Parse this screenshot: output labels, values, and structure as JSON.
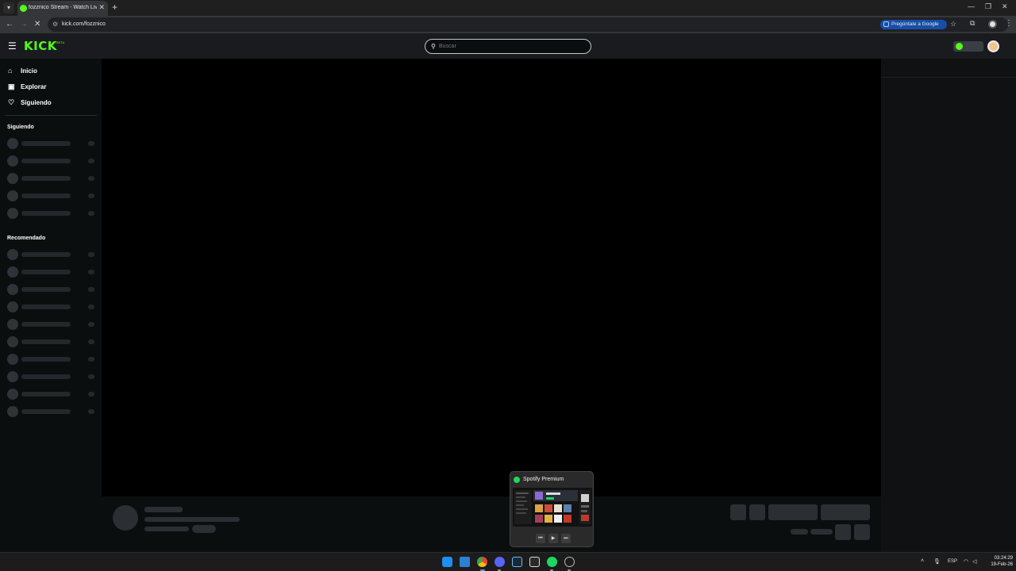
{
  "browser": {
    "tab_title": "fozznico Stream - Watch Live o",
    "tab_close": "✕",
    "new_tab": "+",
    "url": "kick.com/fozznico",
    "google_chip": "Pregúntale a Google",
    "window_controls": [
      "—",
      "❐",
      "✕"
    ]
  },
  "header": {
    "logo": "KICK",
    "logo_badge": "BETA",
    "search_placeholder": "Buscar"
  },
  "sidebar": {
    "nav": [
      {
        "label": "Inicio",
        "icon": "home-icon"
      },
      {
        "label": "Explorar",
        "icon": "compass-icon"
      },
      {
        "label": "Siguiendo",
        "icon": "heart-icon"
      }
    ],
    "following_title": "Siguiendo",
    "recommended_title": "Recomendado"
  },
  "spotify_preview": {
    "title": "Spotify Premium"
  },
  "taskbar": {
    "apps": [
      "windows-start-icon",
      "file-explorer-icon",
      "chrome-icon",
      "discord-icon",
      "steam-icon",
      "epic-games-icon",
      "spotify-icon",
      "other-app-icon"
    ],
    "language": "ESP",
    "time": "03:24:29",
    "date": "19-Feb-26"
  },
  "colors": {
    "kick_green": "#53fc18",
    "spotify_green": "#1ed760",
    "background": "#0b0e0f"
  }
}
